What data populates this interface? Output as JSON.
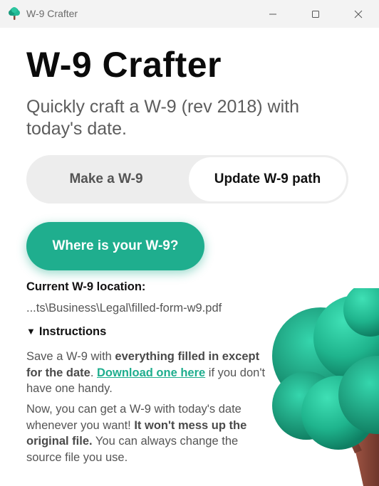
{
  "window": {
    "title": "W-9 Crafter",
    "controls": [
      "minimize-icon",
      "maximize-icon",
      "close-icon"
    ]
  },
  "header": {
    "title": "W-9 Crafter",
    "subtitle": "Quickly craft a W-9 (rev 2018) with today's date."
  },
  "tabs": [
    {
      "label": "Make a W-9",
      "selected": false
    },
    {
      "label": "Update W-9 path",
      "selected": true
    }
  ],
  "primary_button": {
    "label": "Where is your W-9?"
  },
  "location": {
    "label": "Current W-9 location:",
    "path": "...ts\\Business\\Legal\\filled-form-w9.pdf"
  },
  "instructions": {
    "summary": "Instructions",
    "p1_a": "Save a W-9 with ",
    "p1_b": "everything filled in except for the date",
    "p1_c": ". ",
    "p1_link": "Download one here",
    "p1_d": " if you don't have one handy.",
    "p2_a": "Now, you can get a W-9 with today's date whenever you want! ",
    "p2_b": "It won't mess up the original file.",
    "p2_c": " You can always change the source file you use."
  },
  "colors": {
    "accent": "#1fae8e",
    "tab_track": "#ededed",
    "titlebar": "#f3f3f3"
  },
  "illustration": {
    "icon": "tree-icon"
  }
}
